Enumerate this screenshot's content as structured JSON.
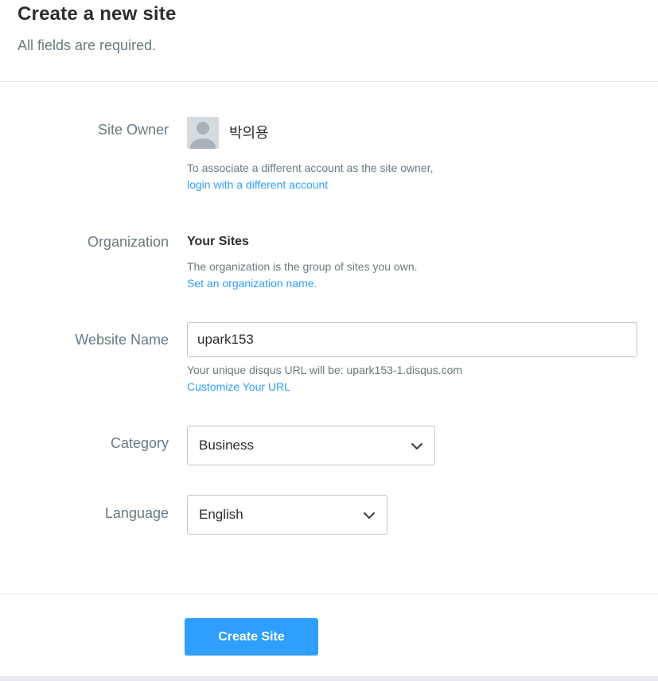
{
  "header": {
    "title": "Create a new site",
    "subtitle": "All fields are required."
  },
  "site_owner": {
    "label": "Site Owner",
    "name": "박의용",
    "help": "To associate a different account as the site owner,",
    "link": "login with a different account"
  },
  "organization": {
    "label": "Organization",
    "name": "Your Sites",
    "help": "The organization is the group of sites you own.",
    "link": "Set an organization name."
  },
  "website_name": {
    "label": "Website Name",
    "value": "upark153",
    "help": "Your unique disqus URL will be: upark153-1.disqus.com",
    "link": "Customize Your URL"
  },
  "category": {
    "label": "Category",
    "selected": "Business"
  },
  "language": {
    "label": "Language",
    "selected": "English"
  },
  "actions": {
    "create_label": "Create Site"
  },
  "colors": {
    "accent": "#2e9fff",
    "label_gray": "#687a86",
    "text_dark": "#2a2e2e"
  },
  "icons": [
    "avatar-placeholder-icon",
    "chevron-down-icon"
  ]
}
